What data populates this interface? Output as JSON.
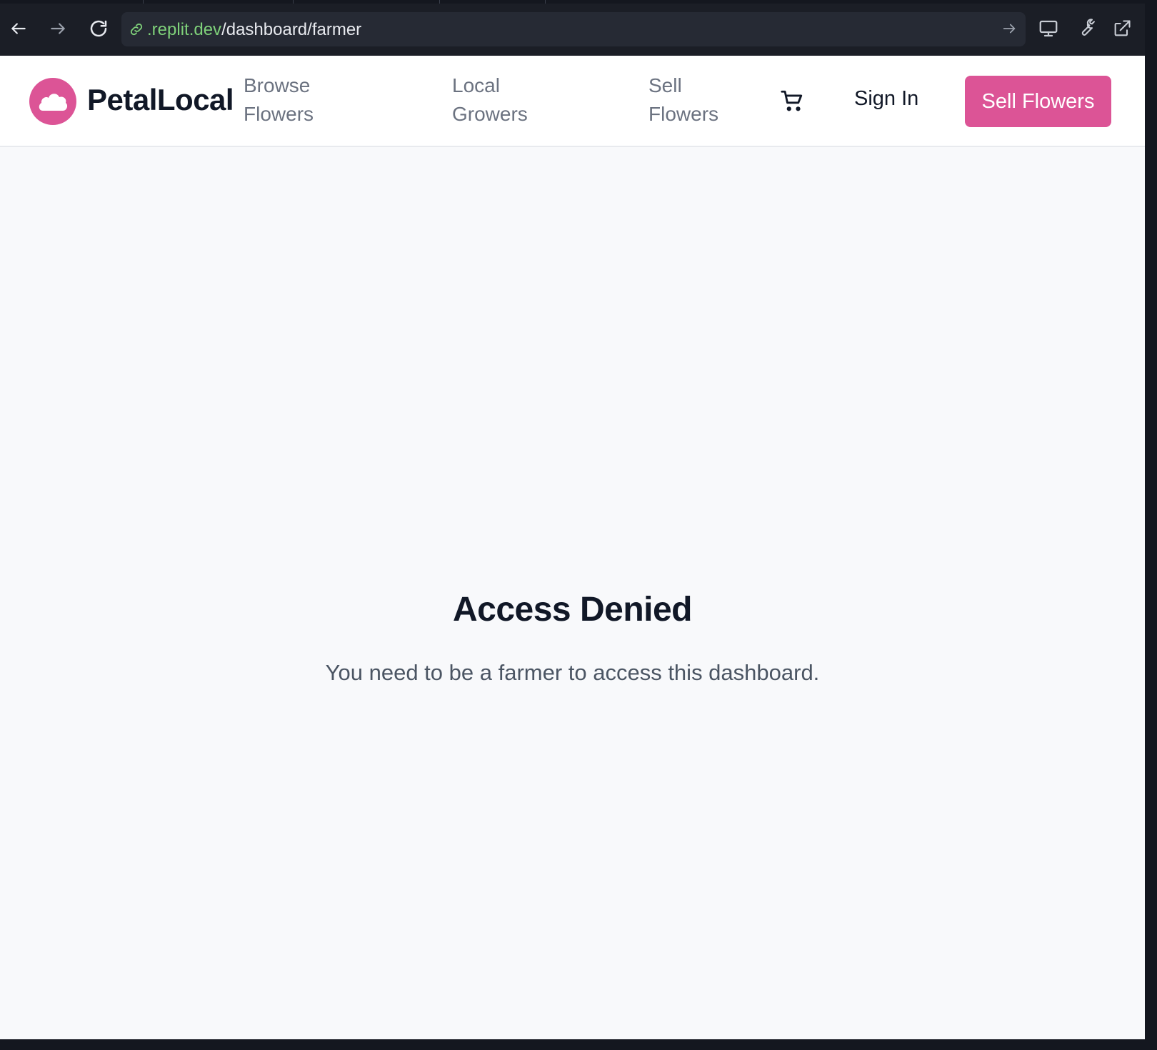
{
  "browser": {
    "url_host": ".replit.dev",
    "url_path": "/dashboard/farmer",
    "icons": [
      "back-icon",
      "forward-icon",
      "reload-icon",
      "link-icon",
      "go-arrow-icon",
      "monitor-icon",
      "wrench-icon",
      "external-link-icon"
    ]
  },
  "header": {
    "brand": "PetalLocal",
    "nav": [
      {
        "line1": "Browse",
        "line2": "Flowers"
      },
      {
        "line1": "Local",
        "line2": "Growers"
      },
      {
        "line1": "Sell",
        "line2": "Flowers"
      }
    ],
    "cart_icon": "cart-icon",
    "sign_in": "Sign In",
    "cta": "Sell Flowers"
  },
  "main": {
    "title": "Access Denied",
    "message": "You need to be a farmer to access this dashboard."
  },
  "colors": {
    "accent": "#dc5496",
    "chrome_bg": "#1b1e26",
    "url_host": "#7fd17a",
    "page_bg": "#f8f9fb"
  }
}
